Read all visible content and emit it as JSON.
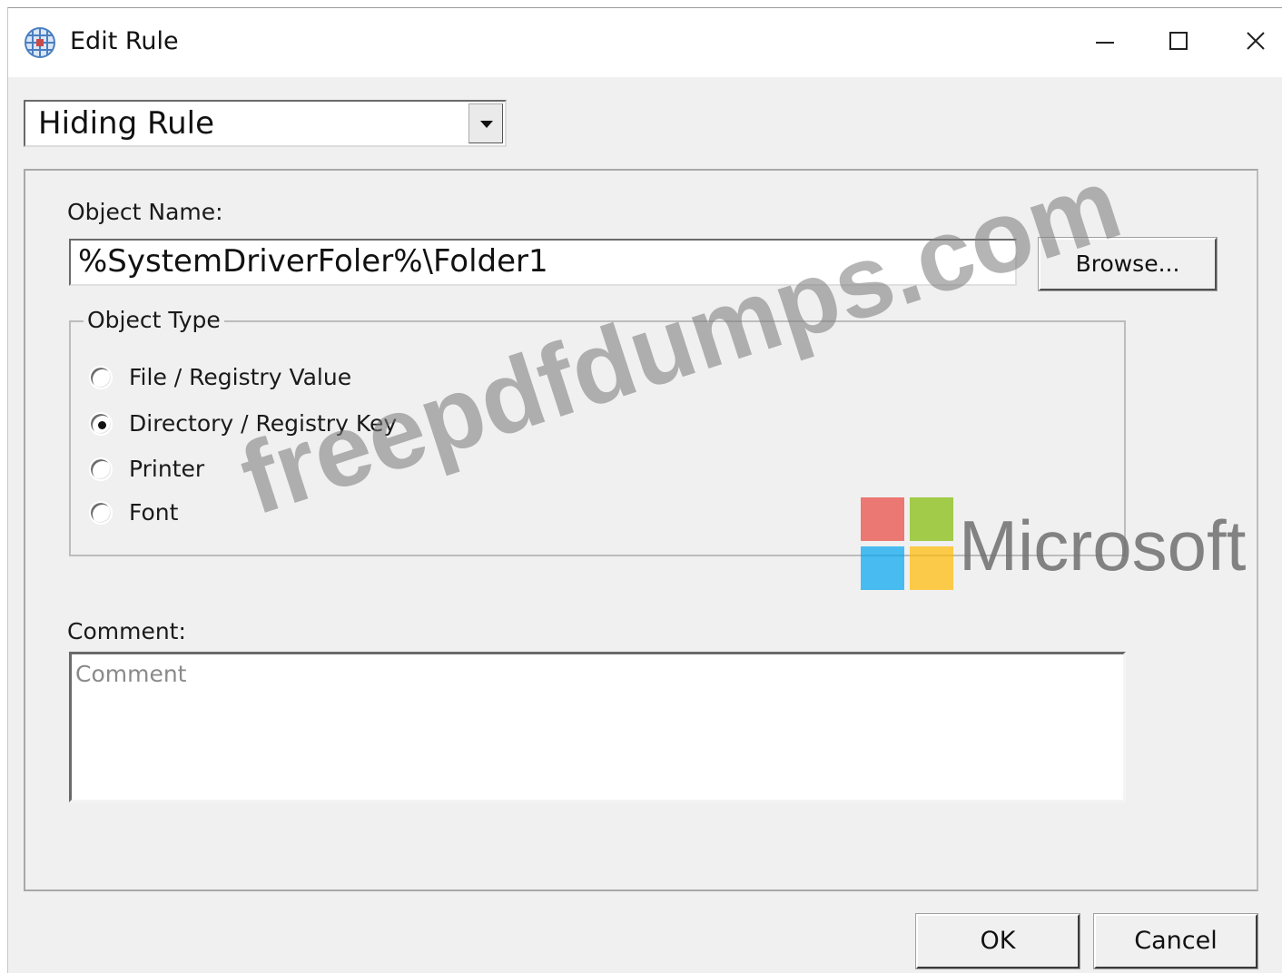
{
  "window": {
    "title": "Edit Rule",
    "controls": [
      "minimize",
      "maximize",
      "close"
    ]
  },
  "rule_type": {
    "selected": "Hiding Rule"
  },
  "object_name": {
    "label": "Object Name:",
    "value": "%SystemDriverFoler%\\Folder1",
    "browse_label": "Browse..."
  },
  "object_type": {
    "legend": "Object Type",
    "options": [
      {
        "label": "File / Registry Value",
        "selected": false
      },
      {
        "label": "Directory / Registry Key",
        "selected": true
      },
      {
        "label": "Printer",
        "selected": false
      },
      {
        "label": "Font",
        "selected": false
      }
    ]
  },
  "comment": {
    "label": "Comment:",
    "placeholder": "Comment",
    "value": ""
  },
  "buttons": {
    "ok": "OK",
    "cancel": "Cancel"
  },
  "watermark": {
    "text": "freepdfdumps.com",
    "brand": "Microsoft",
    "logo_colors": [
      "#e8453c",
      "#7fba00",
      "#00a4ef",
      "#ffb900"
    ]
  }
}
